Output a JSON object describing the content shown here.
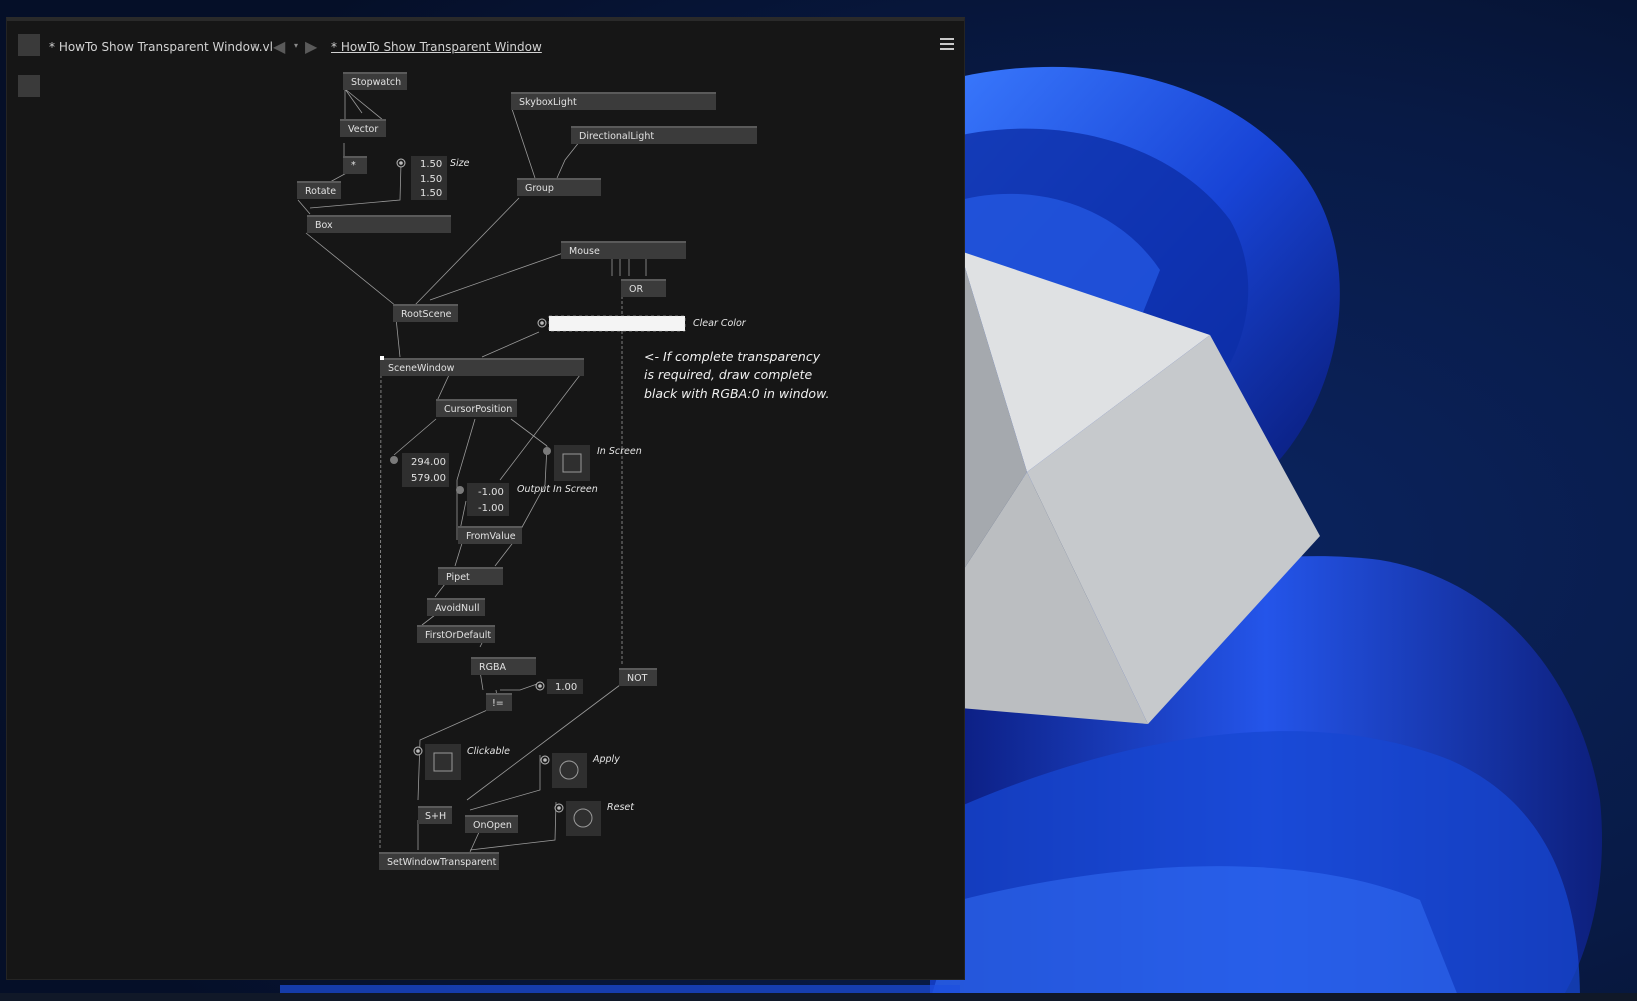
{
  "window": {
    "doc_tab": "* HowTo Show Transparent Window.vl",
    "patch_tab": "* HowTo Show Transparent Window"
  },
  "nodes": {
    "stopwatch": "Stopwatch",
    "vector": "Vector",
    "multiply": "*",
    "rotate": "Rotate",
    "box": "Box",
    "skyboxlight": "SkyboxLight",
    "directionallight": "DirectionalLight",
    "group": "Group",
    "mouse": "Mouse",
    "or": "OR",
    "rootscene": "RootScene",
    "scenewindow": "SceneWindow",
    "cursorposition": "CursorPosition",
    "fromvalue": "FromValue",
    "pipet": "Pipet",
    "avoidnull": "AvoidNull",
    "firstordefault": "FirstOrDefault",
    "rgba": "RGBA",
    "notequal": "!=",
    "not": "NOT",
    "sh": "S+H",
    "onopen": "OnOpen",
    "setwindowtransparent": "SetWindowTransparent"
  },
  "values": {
    "size": [
      "1.50",
      "1.50",
      "1.50"
    ],
    "cursor": [
      "294.00",
      "579.00"
    ],
    "output_in_screen": [
      "-1.00",
      "-1.00"
    ],
    "alpha": "1.00"
  },
  "labels": {
    "size": "Size",
    "clear_color": "Clear Color",
    "in_screen": "In Screen",
    "output_in_screen": "Output In Screen",
    "clickable": "Clickable",
    "apply": "Apply",
    "reset": "Reset"
  },
  "comment": [
    "<- If complete transparency",
    "is required, draw complete",
    "black with RGBA:0 in window."
  ],
  "colors": {
    "editor_bg": "#161616",
    "node_bg": "#3b3b3b",
    "link": "#9a9a9a",
    "wallpaper_blue": "#1a46d8",
    "cube_top": "#dfe1e3"
  }
}
